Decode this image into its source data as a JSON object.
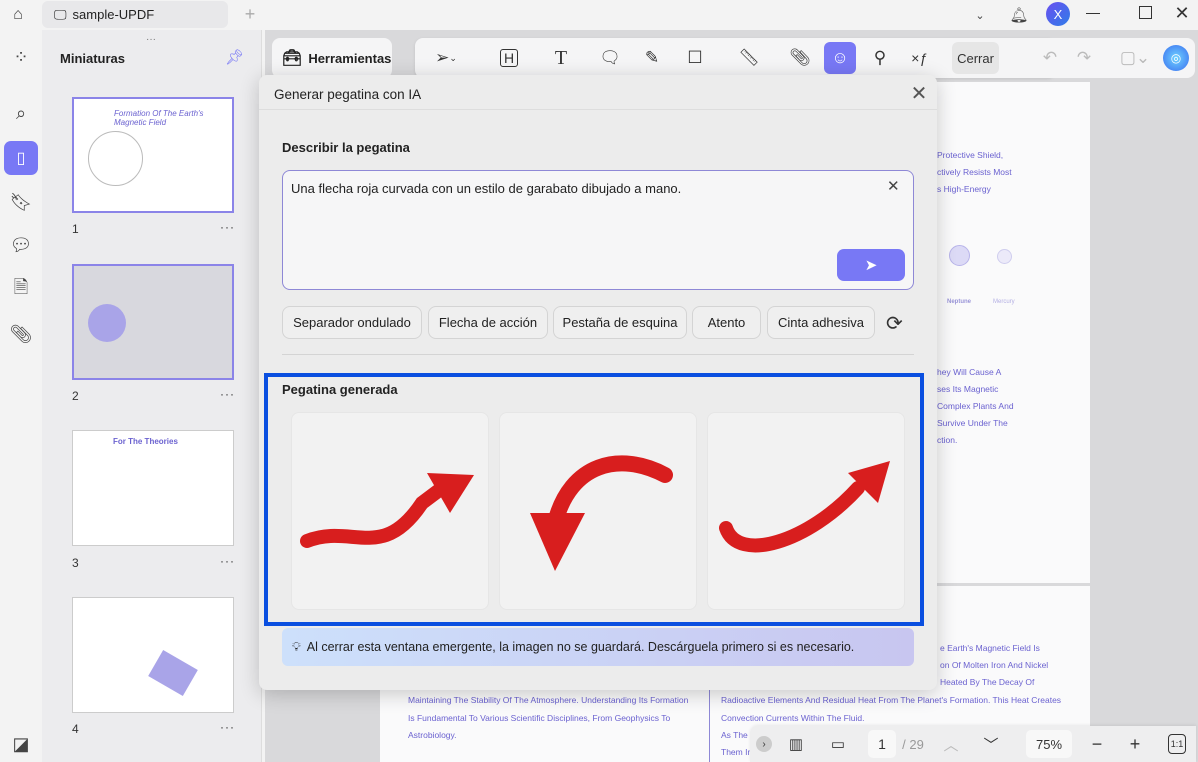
{
  "titlebar": {
    "tab_title": "sample-UPDF",
    "new_tab": "+",
    "user_initial": "X"
  },
  "thumbnails": {
    "title": "Miniaturas",
    "pages": [
      {
        "number": "1",
        "title": "Formation Of The Earth's Magnetic Field"
      },
      {
        "number": "2"
      },
      {
        "number": "3",
        "title": "For The Theories"
      },
      {
        "number": "4"
      }
    ],
    "more": "···"
  },
  "toolbar": {
    "tools_label": "Herramientas",
    "close_label": "Cerrar"
  },
  "dialog": {
    "title": "Generar pegatina con IA",
    "describe_label": "Describir la pegatina",
    "prompt_value": "Una flecha roja curvada con un estilo de garabato dibujado a mano.",
    "suggestions": [
      "Separador ondulado",
      "Flecha de acción",
      "Pestaña de esquina",
      "Atento",
      "Cinta adhesiva"
    ],
    "generated_label": "Pegatina generada",
    "notice": "Al cerrar esta ventana emergente, la imagen no se guardará. Descárguela primero si es necesario.",
    "accent": "#7878f5",
    "highlight": "#0a4fe0"
  },
  "document": {
    "lines_top": [
      "Protective Shield,",
      "ctively Resists Most",
      "s High-Energy"
    ],
    "planets": [
      "Neptune",
      "Mercury"
    ],
    "lines_mid": [
      "hey Will Cause A",
      "ses Its Magnetic",
      "Complex Plants And",
      "Survive Under The",
      "ction."
    ],
    "lines_left": [
      "Maintaining The Stability Of The Atmosphere. Understanding Its Formation",
      "Is Fundamental To Various Scientific Disciplines, From Geophysics To",
      "Astrobiology."
    ],
    "lines_right": [
      "e Earth's Magnetic Field Is",
      "on Of Molten Iron And Nickel",
      "Heated By The Decay Of",
      "Radioactive Elements And Residual Heat From The Planet's Formation. This Heat Creates",
      "Convection Currents Within The Fluid.",
      "As The",
      "Them In"
    ]
  },
  "bottombar": {
    "current_page": "1",
    "total_pages": "/ 29",
    "zoom": "75%",
    "fit": "1:1"
  }
}
